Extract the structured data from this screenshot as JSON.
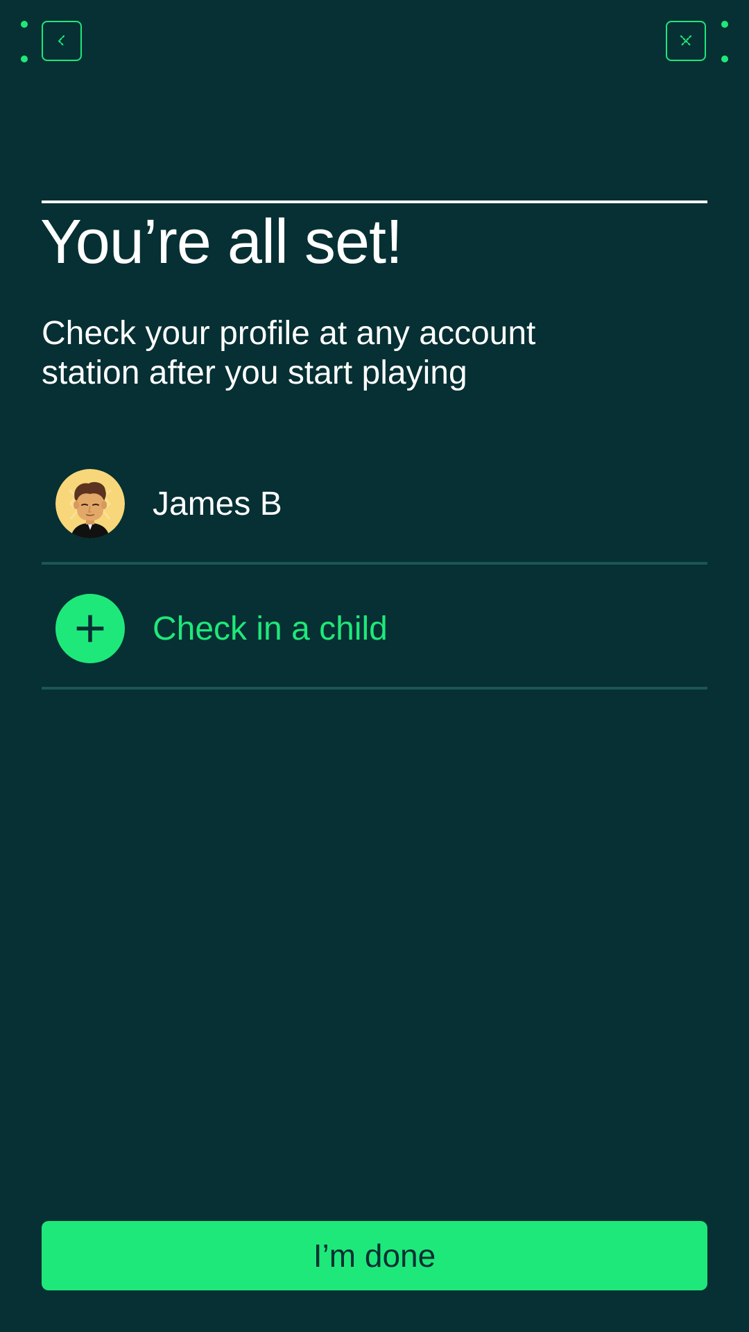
{
  "nav": {
    "back_icon": "chevron-left-icon",
    "close_icon": "close-icon"
  },
  "header": {
    "title": "You’re all set!",
    "subtitle": "Check your profile at any account station after you start playing"
  },
  "profiles": [
    {
      "name": "James B",
      "avatar_icon": "avatar-cartoon-icon"
    }
  ],
  "add_child": {
    "label": "Check in a child",
    "icon": "plus-icon"
  },
  "footer": {
    "done_label": "I’m done"
  },
  "colors": {
    "background": "#063033",
    "accent": "#1fe87a",
    "divider": "#1b5653",
    "text": "#ffffff"
  }
}
